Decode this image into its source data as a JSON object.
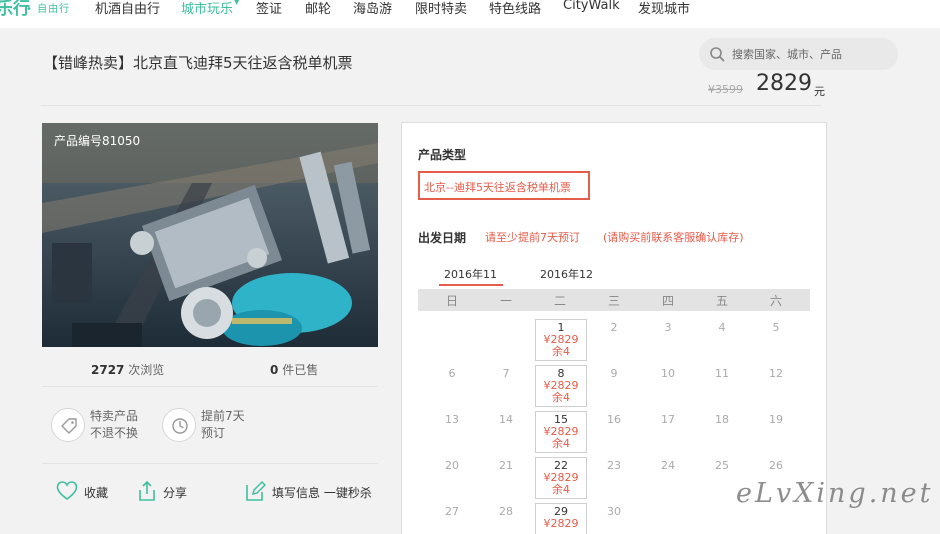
{
  "brand": {
    "logo_text": "乐行",
    "logo_sub": "自由行",
    "accent": "#3fbfa0"
  },
  "nav": {
    "items": [
      {
        "label": "机酒自由行",
        "active": false
      },
      {
        "label": "城市玩乐",
        "active": true
      },
      {
        "label": "签证",
        "active": false
      },
      {
        "label": "邮轮",
        "active": false
      },
      {
        "label": "海岛游",
        "active": false
      },
      {
        "label": "限时特卖",
        "active": false
      },
      {
        "label": "特色线路",
        "active": false
      },
      {
        "label": "CityWalk",
        "active": false
      },
      {
        "label": "发现城市",
        "active": false
      }
    ]
  },
  "search": {
    "placeholder": "搜索国家、城市、产品"
  },
  "product": {
    "title": "【错峰热卖】北京直飞迪拜5天往返含税单机票",
    "old_price": "¥3599",
    "price": "2829",
    "price_unit": "元",
    "code_label": "产品编号81050",
    "views_count": "2727",
    "views_label": "次浏览",
    "sold_count": "0",
    "sold_label": "件已售"
  },
  "features": [
    {
      "icon": "tag-icon",
      "line1": "特卖产品",
      "line2": "不退不换"
    },
    {
      "icon": "clock-icon",
      "line1": "提前7天",
      "line2": "预订"
    }
  ],
  "actions": {
    "favorite": "收藏",
    "share": "分享",
    "fill_info": "填写信息 一键秒杀"
  },
  "booking": {
    "type_label": "产品类型",
    "type_option": "北京--迪拜5天往返含税单机票",
    "date_label": "出发日期",
    "note1": "请至少提前7天预订",
    "note2": "(请购买前联系客服确认库存)",
    "months": [
      "2016年11",
      "2016年12"
    ],
    "weekdays": [
      "日",
      "一",
      "二",
      "三",
      "四",
      "五",
      "六"
    ],
    "available": [
      {
        "day": "1",
        "price": "¥2829",
        "left": "余4"
      },
      {
        "day": "8",
        "price": "¥2829",
        "left": "余4"
      },
      {
        "day": "15",
        "price": "¥2829",
        "left": "余4"
      },
      {
        "day": "22",
        "price": "¥2829",
        "left": "余4"
      },
      {
        "day": "29",
        "price": "¥2829",
        "left": ""
      }
    ],
    "rows": [
      [
        "",
        "",
        "",
        "2",
        "3",
        "4",
        "5"
      ],
      [
        "6",
        "7",
        "",
        "9",
        "10",
        "11",
        "12"
      ],
      [
        "13",
        "14",
        "",
        "16",
        "17",
        "18",
        "19"
      ],
      [
        "20",
        "21",
        "",
        "23",
        "24",
        "25",
        "26"
      ],
      [
        "27",
        "28",
        "",
        "30",
        "",
        "",
        ""
      ]
    ],
    "highlight_color": "#e45c4a"
  },
  "watermark": "eLvXing.net"
}
